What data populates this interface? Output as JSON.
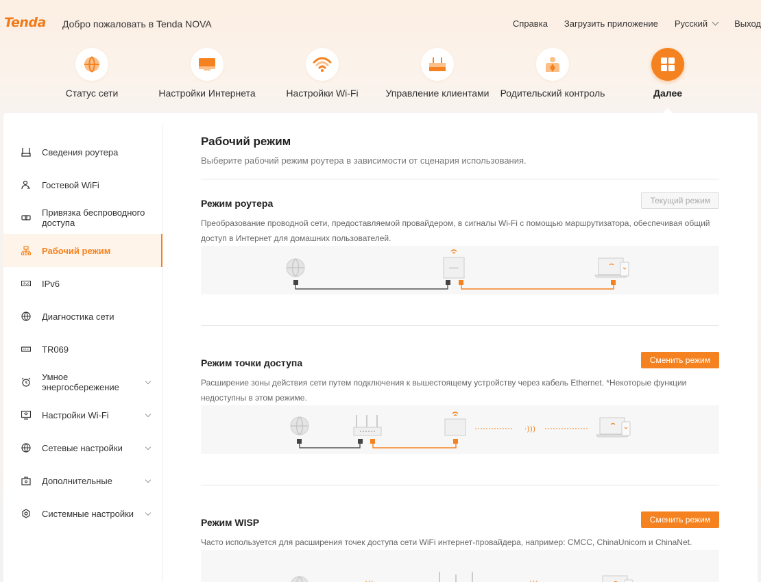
{
  "header": {
    "logo": "Tenda",
    "welcome": "Добро пожаловать в Tenda NOVA",
    "links": {
      "help": "Справка",
      "download": "Загрузить приложение",
      "language": "Русский",
      "logout": "Выход"
    }
  },
  "nav": [
    {
      "label": "Статус сети",
      "icon": "globe-icon"
    },
    {
      "label": "Настройки Интернета",
      "icon": "monitor-icon"
    },
    {
      "label": "Настройки Wi-Fi",
      "icon": "wifi-icon"
    },
    {
      "label": "Управление клиентами",
      "icon": "router-icon"
    },
    {
      "label": "Родительский контроль",
      "icon": "parent-icon"
    },
    {
      "label": "Далее",
      "icon": "grid-icon",
      "active": true
    }
  ],
  "sidebar": [
    {
      "label": "Сведения роутера",
      "icon": "router-info-icon"
    },
    {
      "label": "Гостевой WiFi",
      "icon": "guest-icon"
    },
    {
      "label": "Привязка беспроводного доступа",
      "icon": "link-icon"
    },
    {
      "label": "Рабочий режим",
      "icon": "mode-icon",
      "active": true
    },
    {
      "label": "IPv6",
      "icon": "ipv6-icon"
    },
    {
      "label": "Диагностика сети",
      "icon": "globe-icon"
    },
    {
      "label": "TR069",
      "icon": "tr069-icon"
    },
    {
      "label": "Умное энергосбережение",
      "icon": "alarm-icon",
      "expandable": true
    },
    {
      "label": "Настройки Wi-Fi",
      "icon": "wifi-settings-icon",
      "expandable": true
    },
    {
      "label": "Сетевые настройки",
      "icon": "globe-icon",
      "expandable": true
    },
    {
      "label": "Дополнительные",
      "icon": "toolbox-icon",
      "expandable": true
    },
    {
      "label": "Системные настройки",
      "icon": "gear-icon",
      "expandable": true
    }
  ],
  "content": {
    "title": "Рабочий режим",
    "subtitle": "Выберите рабочий режим роутера в зависимости от сценария использования.",
    "modes": [
      {
        "title": "Режим роутера",
        "button": "Текущий режим",
        "button_state": "current",
        "description": "Преобразование проводной сети, предоставляемой провайдером, в сигналы Wi-Fi с помощью маршрутизатора, обеспечивая общий доступ в Интернет для домашних пользователей."
      },
      {
        "title": "Режим точки доступа",
        "button": "Сменить режим",
        "button_state": "switch",
        "description": "Расширение зоны действия сети путем подключения к вышестоящему устройству через кабель Ethernet. *Некоторые функции недоступны в этом режиме."
      },
      {
        "title": "Режим WISP",
        "button": "Сменить режим",
        "button_state": "switch",
        "description": "Часто используется для расширения точек доступа сети WiFi интернет-провайдера, например: CMCC, ChinaUnicom и ChinaNet."
      }
    ]
  },
  "colors": {
    "accent": "#f58220",
    "cable_dark": "#555555"
  }
}
